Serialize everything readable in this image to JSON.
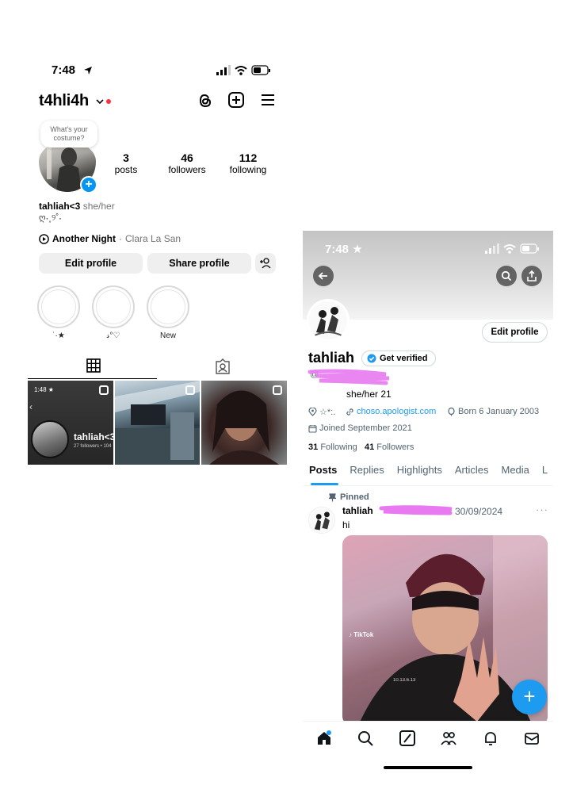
{
  "instagram": {
    "status_time": "7:48",
    "username": "t4hli4h",
    "note": "What's your costume?",
    "stats": [
      {
        "num": "3",
        "label": "posts"
      },
      {
        "num": "46",
        "label": "followers"
      },
      {
        "num": "112",
        "label": "following"
      }
    ],
    "display_name": "tahliah<3",
    "pronouns": "she/her",
    "bio_line": "ღ˖˳୨˚˖",
    "music": {
      "song": "Another Night",
      "artist": "Clara La San",
      "separator": " · "
    },
    "buttons": {
      "edit": "Edit profile",
      "share": "Share profile"
    },
    "highlights": [
      {
        "label": "˙·★"
      },
      {
        "label": "𝓈°♡"
      },
      {
        "label": "New"
      }
    ],
    "grid_tile_1": {
      "time": "1:48 ★",
      "name": "tahliah<3",
      "sub": "27 followers • 104"
    },
    "icons": {
      "threads": "threads-icon",
      "create": "plus-square-icon",
      "menu": "hamburger-menu-icon",
      "grid": "grid-icon",
      "tagged": "tagged-person-icon",
      "discover": "add-person-icon"
    }
  },
  "x": {
    "status_time": "7:48 ★",
    "edit_profile": "Edit profile",
    "name": "tahliah",
    "verified_label": "Get verified",
    "handle_prefix": "@",
    "bio": "she/her 21",
    "location": "☆*:.",
    "link": "choso.apologist.com",
    "born": "Born 6 January 2003",
    "joined": "Joined September 2021",
    "following_count": "31",
    "following_label": "Following",
    "followers_count": "41",
    "followers_label": "Followers",
    "tabs": [
      "Posts",
      "Replies",
      "Highlights",
      "Articles",
      "Media",
      "L"
    ],
    "pinned_label": "Pinned",
    "post": {
      "author": "tahliah",
      "date": "30/09/2024",
      "text": "hi",
      "more": "···"
    },
    "media_watermark": "TikTok",
    "colors": {
      "accent": "#1d9bf0",
      "verified_badge": "#1d9bf0",
      "scribble": "#e879f0"
    }
  }
}
